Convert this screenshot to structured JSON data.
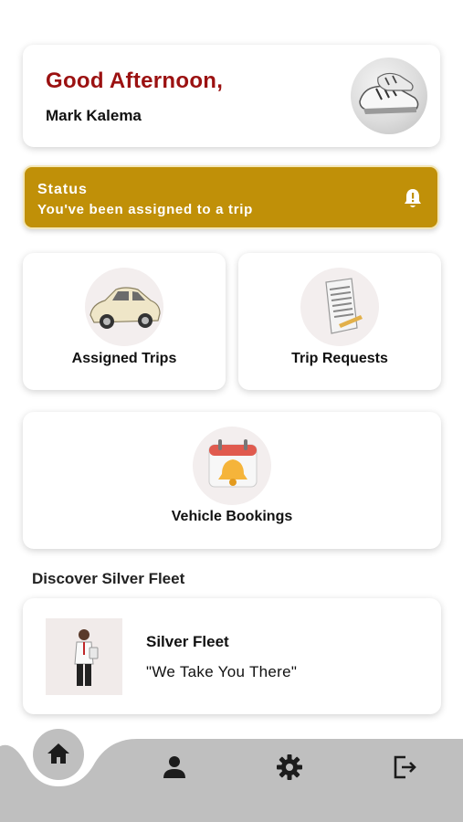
{
  "greeting": {
    "title": "Good Afternoon,",
    "name": "Mark Kalema"
  },
  "status": {
    "title": "Status",
    "message": "You've been assigned to a trip"
  },
  "tiles": {
    "assigned_trips": "Assigned Trips",
    "trip_requests": "Trip Requests",
    "vehicle_bookings": "Vehicle Bookings"
  },
  "discover": {
    "heading": "Discover Silver Fleet",
    "company_name": "Silver Fleet",
    "tagline": "\"We Take You There\""
  },
  "nav": {
    "active": "home",
    "items": [
      "home-icon",
      "profile-icon",
      "settings-icon",
      "logout-icon"
    ]
  },
  "colors": {
    "accent_red": "#9b1111",
    "status_gold": "#c09008",
    "nav_gray": "#bfbfbf"
  }
}
